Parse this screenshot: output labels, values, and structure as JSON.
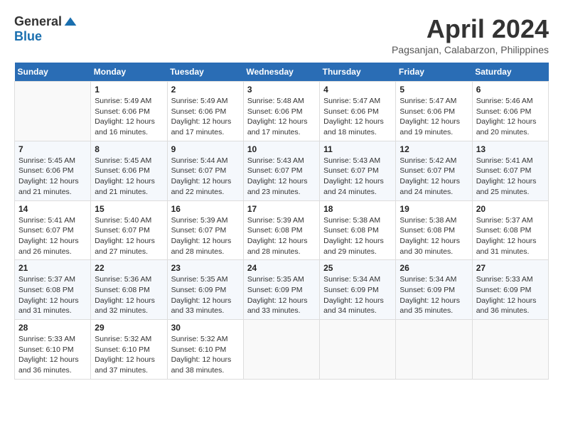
{
  "header": {
    "logo_general": "General",
    "logo_blue": "Blue",
    "month_title": "April 2024",
    "location": "Pagsanjan, Calabarzon, Philippines"
  },
  "days_of_week": [
    "Sunday",
    "Monday",
    "Tuesday",
    "Wednesday",
    "Thursday",
    "Friday",
    "Saturday"
  ],
  "weeks": [
    [
      {
        "day": "",
        "info": ""
      },
      {
        "day": "1",
        "info": "Sunrise: 5:49 AM\nSunset: 6:06 PM\nDaylight: 12 hours\nand 16 minutes."
      },
      {
        "day": "2",
        "info": "Sunrise: 5:49 AM\nSunset: 6:06 PM\nDaylight: 12 hours\nand 17 minutes."
      },
      {
        "day": "3",
        "info": "Sunrise: 5:48 AM\nSunset: 6:06 PM\nDaylight: 12 hours\nand 17 minutes."
      },
      {
        "day": "4",
        "info": "Sunrise: 5:47 AM\nSunset: 6:06 PM\nDaylight: 12 hours\nand 18 minutes."
      },
      {
        "day": "5",
        "info": "Sunrise: 5:47 AM\nSunset: 6:06 PM\nDaylight: 12 hours\nand 19 minutes."
      },
      {
        "day": "6",
        "info": "Sunrise: 5:46 AM\nSunset: 6:06 PM\nDaylight: 12 hours\nand 20 minutes."
      }
    ],
    [
      {
        "day": "7",
        "info": "Sunrise: 5:45 AM\nSunset: 6:06 PM\nDaylight: 12 hours\nand 21 minutes."
      },
      {
        "day": "8",
        "info": "Sunrise: 5:45 AM\nSunset: 6:06 PM\nDaylight: 12 hours\nand 21 minutes."
      },
      {
        "day": "9",
        "info": "Sunrise: 5:44 AM\nSunset: 6:07 PM\nDaylight: 12 hours\nand 22 minutes."
      },
      {
        "day": "10",
        "info": "Sunrise: 5:43 AM\nSunset: 6:07 PM\nDaylight: 12 hours\nand 23 minutes."
      },
      {
        "day": "11",
        "info": "Sunrise: 5:43 AM\nSunset: 6:07 PM\nDaylight: 12 hours\nand 24 minutes."
      },
      {
        "day": "12",
        "info": "Sunrise: 5:42 AM\nSunset: 6:07 PM\nDaylight: 12 hours\nand 24 minutes."
      },
      {
        "day": "13",
        "info": "Sunrise: 5:41 AM\nSunset: 6:07 PM\nDaylight: 12 hours\nand 25 minutes."
      }
    ],
    [
      {
        "day": "14",
        "info": "Sunrise: 5:41 AM\nSunset: 6:07 PM\nDaylight: 12 hours\nand 26 minutes."
      },
      {
        "day": "15",
        "info": "Sunrise: 5:40 AM\nSunset: 6:07 PM\nDaylight: 12 hours\nand 27 minutes."
      },
      {
        "day": "16",
        "info": "Sunrise: 5:39 AM\nSunset: 6:07 PM\nDaylight: 12 hours\nand 28 minutes."
      },
      {
        "day": "17",
        "info": "Sunrise: 5:39 AM\nSunset: 6:08 PM\nDaylight: 12 hours\nand 28 minutes."
      },
      {
        "day": "18",
        "info": "Sunrise: 5:38 AM\nSunset: 6:08 PM\nDaylight: 12 hours\nand 29 minutes."
      },
      {
        "day": "19",
        "info": "Sunrise: 5:38 AM\nSunset: 6:08 PM\nDaylight: 12 hours\nand 30 minutes."
      },
      {
        "day": "20",
        "info": "Sunrise: 5:37 AM\nSunset: 6:08 PM\nDaylight: 12 hours\nand 31 minutes."
      }
    ],
    [
      {
        "day": "21",
        "info": "Sunrise: 5:37 AM\nSunset: 6:08 PM\nDaylight: 12 hours\nand 31 minutes."
      },
      {
        "day": "22",
        "info": "Sunrise: 5:36 AM\nSunset: 6:08 PM\nDaylight: 12 hours\nand 32 minutes."
      },
      {
        "day": "23",
        "info": "Sunrise: 5:35 AM\nSunset: 6:09 PM\nDaylight: 12 hours\nand 33 minutes."
      },
      {
        "day": "24",
        "info": "Sunrise: 5:35 AM\nSunset: 6:09 PM\nDaylight: 12 hours\nand 33 minutes."
      },
      {
        "day": "25",
        "info": "Sunrise: 5:34 AM\nSunset: 6:09 PM\nDaylight: 12 hours\nand 34 minutes."
      },
      {
        "day": "26",
        "info": "Sunrise: 5:34 AM\nSunset: 6:09 PM\nDaylight: 12 hours\nand 35 minutes."
      },
      {
        "day": "27",
        "info": "Sunrise: 5:33 AM\nSunset: 6:09 PM\nDaylight: 12 hours\nand 36 minutes."
      }
    ],
    [
      {
        "day": "28",
        "info": "Sunrise: 5:33 AM\nSunset: 6:10 PM\nDaylight: 12 hours\nand 36 minutes."
      },
      {
        "day": "29",
        "info": "Sunrise: 5:32 AM\nSunset: 6:10 PM\nDaylight: 12 hours\nand 37 minutes."
      },
      {
        "day": "30",
        "info": "Sunrise: 5:32 AM\nSunset: 6:10 PM\nDaylight: 12 hours\nand 38 minutes."
      },
      {
        "day": "",
        "info": ""
      },
      {
        "day": "",
        "info": ""
      },
      {
        "day": "",
        "info": ""
      },
      {
        "day": "",
        "info": ""
      }
    ]
  ]
}
